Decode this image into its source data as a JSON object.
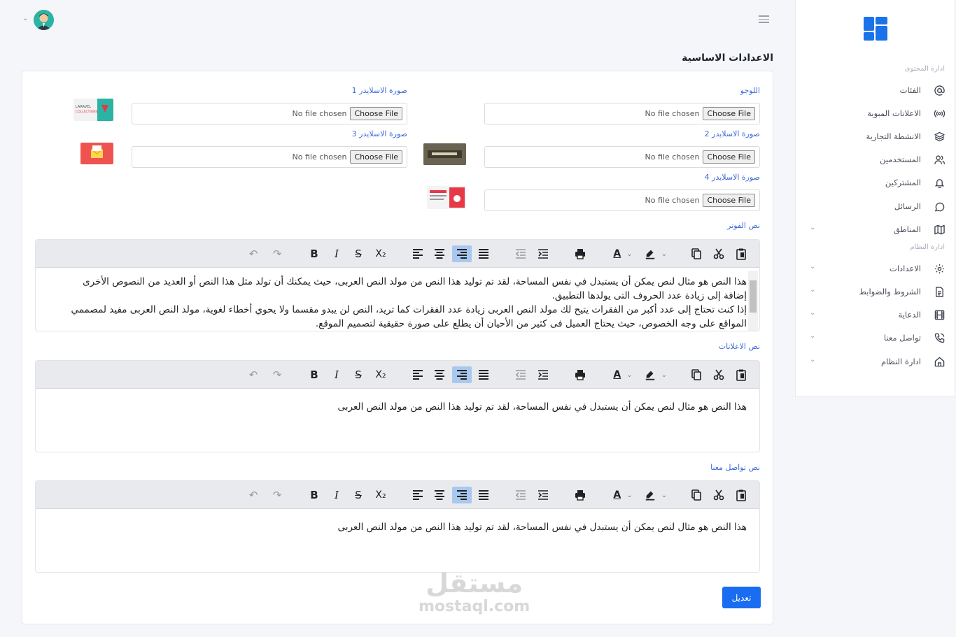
{
  "header": {
    "title": "الاعدادات الاساسية"
  },
  "sidebar": {
    "section_content": "ادارة المحتوى",
    "section_system": "ادارة النظام",
    "items": [
      {
        "label": "الفئات",
        "icon": "at-icon"
      },
      {
        "label": "الاعلانات المبوبة",
        "icon": "broadcast-icon"
      },
      {
        "label": "الانشطة التجارية",
        "icon": "layers-icon"
      },
      {
        "label": "المستخدمين",
        "icon": "users-icon"
      },
      {
        "label": "المشتركين",
        "icon": "bell-icon"
      },
      {
        "label": "الرسائل",
        "icon": "chat-icon"
      },
      {
        "label": "المناطق",
        "icon": "map-icon"
      },
      {
        "label": "الاعدادات",
        "icon": "gear-icon"
      },
      {
        "label": "الشروط والضوابط",
        "icon": "document-icon"
      },
      {
        "label": "الدعاية",
        "icon": "film-icon"
      },
      {
        "label": "تواصل معنا",
        "icon": "phone-icon"
      },
      {
        "label": "ادارة النظام",
        "icon": "home-icon"
      }
    ]
  },
  "uploads": {
    "no_file": "No file chosen",
    "choose": "Choose File",
    "logo_label": "اللوجو",
    "slider1_label": "صورة الاسلايدر 1",
    "slider2_label": "صورة الاسلايدر 2",
    "slider3_label": "صورة الاسلايدر 3",
    "slider4_label": "صورة الاسلايدر 4"
  },
  "editors": {
    "footer_label": "نص الفوتر",
    "footer_text_1": "هذا النص هو مثال لنص يمكن أن يستبدل في نفس المساحة، لقد تم توليد هذا النص من مولد النص العربى، حيث يمكنك أن تولد مثل هذا النص أو العديد من النصوص الأخرى إضافة إلى زيادة عدد الحروف التى يولدها التطبيق.",
    "footer_text_2": "إذا كنت تحتاج إلى عدد أكبر من الفقرات يتيح لك مولد النص العربى زيادة عدد الفقرات كما تريد، النص لن يبدو مقسما ولا يحوي أخطاء لغوية، مولد النص العربى مفيد لمصممي المواقع على وجه الخصوص، حيث يحتاج العميل فى كثير من الأحيان أن يطلع على صورة حقيقية لتصميم الموقع.",
    "ads_label": "نص الاعلانات",
    "ads_text": "هذا النص هو مثال لنص يمكن أن يستبدل في نفس المساحة، لقد تم توليد هذا النص من مولد النص العربى",
    "contact_label": "نص تواصل معنا",
    "contact_text": "هذا النص هو مثال لنص يمكن أن يستبدل في نفس المساحة، لقد تم توليد هذا النص من مولد النص العربى"
  },
  "thumbs": {
    "laravel_line1": "LARAVEL",
    "laravel_line2": "COLLECTIONS"
  },
  "actions": {
    "submit": "تعديل"
  },
  "watermark": {
    "ar": "مستقل",
    "en": "mostaql.com"
  },
  "colors": {
    "accent": "#1a6df0",
    "label": "#3f6bd8",
    "logo": "#1a73e8"
  }
}
